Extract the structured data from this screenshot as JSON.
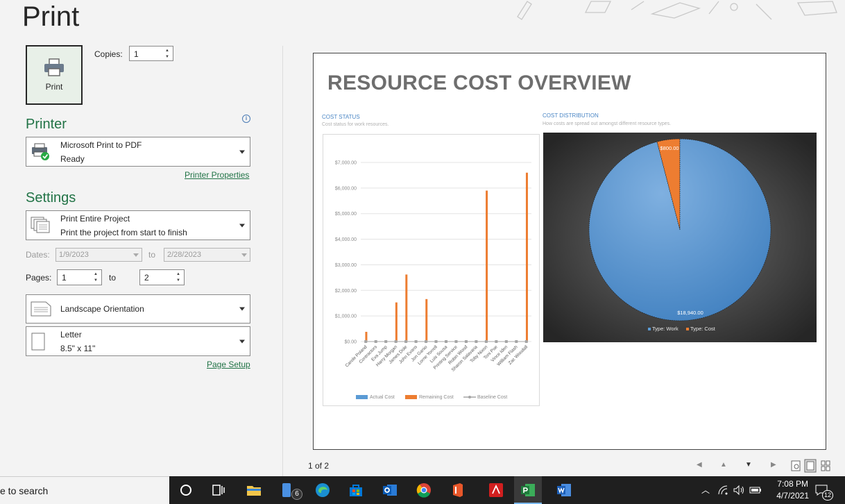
{
  "page": {
    "title": "Print"
  },
  "print_button": {
    "label": "Print"
  },
  "copies": {
    "label": "Copies:",
    "value": "1"
  },
  "printer": {
    "heading": "Printer",
    "name": "Microsoft Print to PDF",
    "status": "Ready",
    "properties_link": "Printer Properties"
  },
  "settings": {
    "heading": "Settings",
    "range_title": "Print Entire Project",
    "range_desc": "Print the project from start to finish",
    "dates_label": "Dates:",
    "date_from": "1/9/2023",
    "date_to_label": "to",
    "date_to": "2/28/2023",
    "pages_label": "Pages:",
    "page_from": "1",
    "page_to_label": "to",
    "page_to": "2",
    "orientation": "Landscape Orientation",
    "paper_name": "Letter",
    "paper_size": "8.5\" x 11\"",
    "page_setup_link": "Page Setup"
  },
  "preview": {
    "report_title": "RESOURCE COST OVERVIEW",
    "left_heading": "COST STATUS",
    "left_desc": "Cost status for work resources.",
    "right_heading": "COST DISTRIBUTION",
    "right_desc": "How costs are spread out amongst different resource types.",
    "page_indicator": "1 of 2"
  },
  "chart_data": [
    {
      "type": "bar",
      "title": "COST STATUS",
      "categories": [
        "Carole Poland",
        "Contractors",
        "Eva Jump",
        "Harry Morgan",
        "James Dole",
        "John Evans",
        "Jon Ganio",
        "Lorne Yorrell",
        "Luis Sousa",
        "Printing Service",
        "Robin Wood",
        "Sharon Salavaria",
        "Toby Nixon",
        "Toni Poe",
        "Vince Iden",
        "William Flash",
        "Zac Woodall"
      ],
      "series": [
        {
          "name": "Actual Cost",
          "values": [
            0,
            0,
            0,
            0,
            0,
            0,
            0,
            0,
            0,
            0,
            0,
            0,
            0,
            0,
            0,
            0,
            0
          ]
        },
        {
          "name": "Remaining Cost",
          "values": [
            380,
            0,
            0,
            1530,
            2620,
            0,
            1660,
            0,
            0,
            0,
            0,
            0,
            5900,
            0,
            0,
            0,
            6600
          ]
        },
        {
          "name": "Baseline Cost",
          "values": [
            0,
            0,
            0,
            0,
            0,
            0,
            0,
            0,
            0,
            0,
            0,
            0,
            0,
            0,
            0,
            0,
            0
          ]
        }
      ],
      "yticks": [
        "$0.00",
        "$1,000.00",
        "$2,000.00",
        "$3,000.00",
        "$4,000.00",
        "$5,000.00",
        "$6,000.00",
        "$7,000.00"
      ],
      "ylim": [
        0,
        7000
      ],
      "legend": "bottom",
      "colors": {
        "Actual Cost": "#5b9bd5",
        "Remaining Cost": "#ed7d31",
        "Baseline Cost": "#a5a5a5"
      }
    },
    {
      "type": "pie",
      "title": "COST DISTRIBUTION",
      "categories": [
        "Type: Work",
        "Type: Cost"
      ],
      "values": [
        18940,
        800
      ],
      "labels": [
        "$18,940.00",
        "$800.00"
      ],
      "legend": "bottom",
      "colors": {
        "Type: Work": "#5b9bd5",
        "Type: Cost": "#ed7d31"
      }
    }
  ],
  "taskbar": {
    "search_text": "e to search",
    "time": "7:08 PM",
    "date": "4/7/2021",
    "teams_badge": "6",
    "notifications": "12"
  }
}
